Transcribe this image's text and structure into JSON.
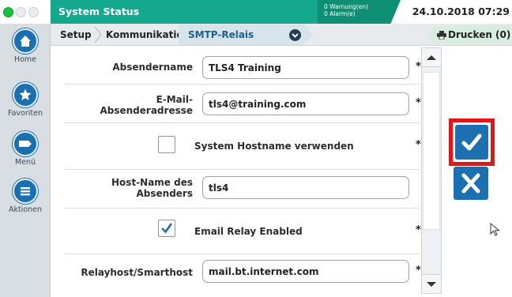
{
  "top_bar": {
    "title": "System Status",
    "warnings": "0 Warnung(en)",
    "alarms": "0 Alarm(e)",
    "datetime": "24.10.2018 07:29",
    "accent": "#14a98f"
  },
  "sidebar": {
    "items": [
      {
        "label": "Home",
        "icon": "home-icon"
      },
      {
        "label": "Favoriten",
        "icon": "star-icon"
      },
      {
        "label": "Menü",
        "icon": "menu-icon"
      },
      {
        "label": "Aktionen",
        "icon": "actions-icon"
      }
    ]
  },
  "breadcrumb": {
    "items": [
      "Setup",
      "Kommunikation",
      "SMTP-Relais"
    ],
    "print_label": "Drucken (0)"
  },
  "form": {
    "rows": [
      {
        "label": "Absendername",
        "value": "TLS4 Training",
        "required": "*"
      },
      {
        "label_line1": "E-Mail-",
        "label_line2": "Absenderadresse",
        "value": "tls4@training.com",
        "required": "*"
      },
      {
        "label": "System Hostname verwenden",
        "checked": false,
        "required": "*"
      },
      {
        "label_line1": "Host-Name des",
        "label_line2": "Absenders",
        "value": "tls4",
        "required": ""
      },
      {
        "label": "Email Relay Enabled",
        "checked": true,
        "required": "*"
      },
      {
        "label": "Relayhost/Smarthost",
        "value": "mail.bt.internet.com",
        "required": "*"
      }
    ]
  },
  "actions": {
    "confirm_icon": "checkmark-icon",
    "cancel_icon": "close-icon",
    "highlight_color": "#e0161b"
  }
}
